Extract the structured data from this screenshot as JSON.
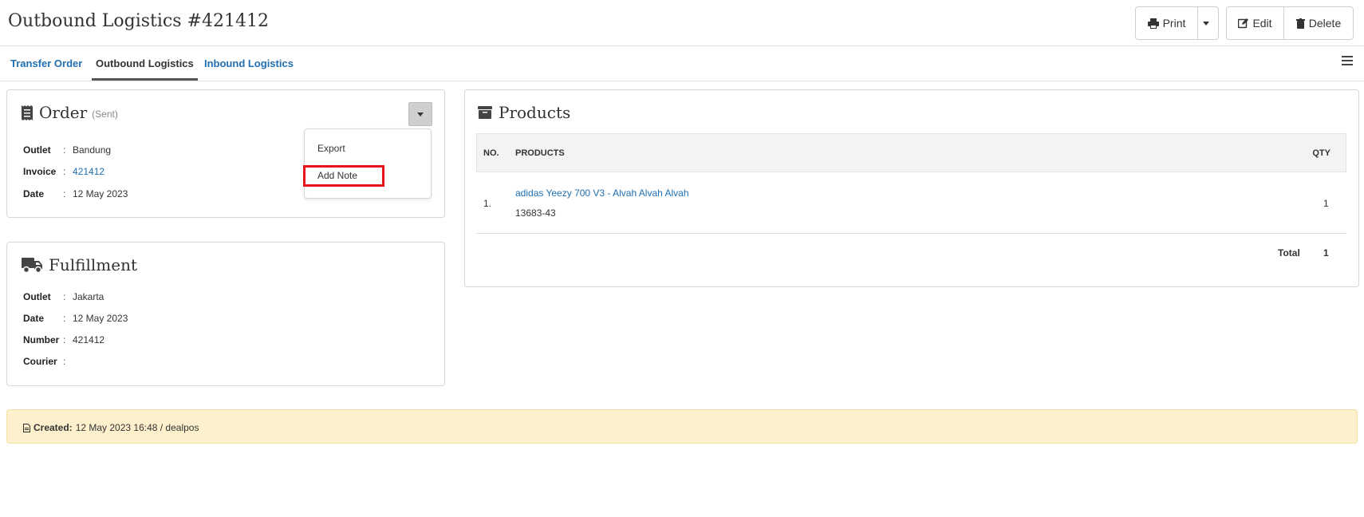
{
  "header": {
    "title": "Outbound Logistics #421412",
    "print_label": "Print",
    "edit_label": "Edit",
    "delete_label": "Delete"
  },
  "tabs": [
    {
      "label": "Transfer Order"
    },
    {
      "label": "Outbound Logistics"
    },
    {
      "label": "Inbound Logistics"
    }
  ],
  "order": {
    "title": "Order",
    "status": "(Sent)",
    "fields": [
      {
        "label": "Outlet",
        "sep": ":",
        "value": "Bandung"
      },
      {
        "label": "Invoice",
        "sep": ":",
        "value": "421412"
      },
      {
        "label": "Date",
        "sep": ":",
        "value": "12 May 2023"
      }
    ],
    "dropdown": {
      "items": [
        {
          "label": "Export"
        },
        {
          "label": "Add Note"
        }
      ]
    }
  },
  "fulfillment": {
    "title": "Fulfillment",
    "fields": [
      {
        "label": "Outlet",
        "sep": ":",
        "value": "Jakarta"
      },
      {
        "label": "Date",
        "sep": ":",
        "value": "12 May 2023"
      },
      {
        "label": "Number",
        "sep": ":",
        "value": "421412"
      },
      {
        "label": "Courier",
        "sep": ":",
        "value": ""
      }
    ]
  },
  "products": {
    "title": "Products",
    "columns": {
      "no": "NO.",
      "products": "PRODUCTS",
      "qty": "QTY"
    },
    "rows": [
      {
        "no": "1.",
        "name": "adidas Yeezy 700 V3 - Alvah Alvah Alvah",
        "sku": "13683-43",
        "qty": "1"
      }
    ],
    "total_label": "Total",
    "total_value": "1"
  },
  "footer": {
    "created_label": "Created:",
    "created_value": "12 May 2023 16:48 / dealpos"
  },
  "colors": {
    "link": "#1f6fb2",
    "highlight": "#e8141b",
    "footer_bg": "#fdf1cd"
  }
}
